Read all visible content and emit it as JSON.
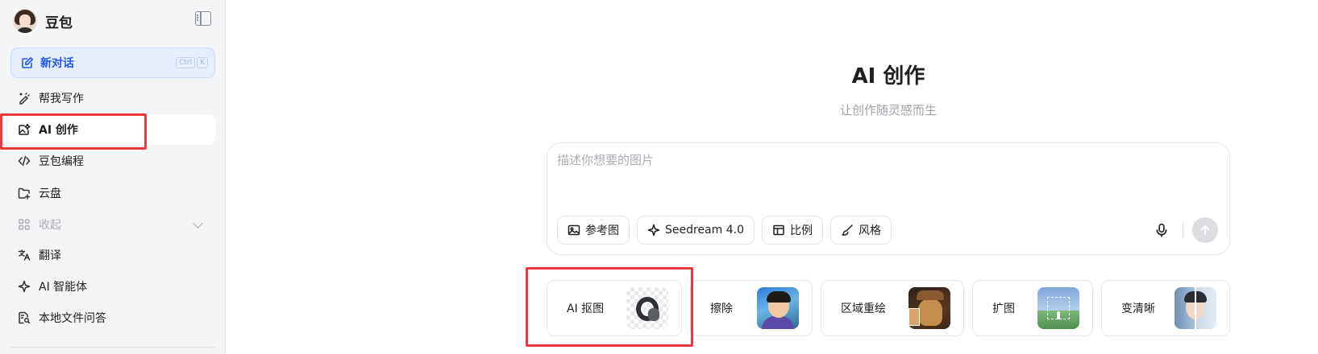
{
  "sidebar": {
    "app_name": "豆包",
    "new_chat": {
      "label": "新对话",
      "shortcut": [
        "Ctrl",
        "K"
      ]
    },
    "items": [
      {
        "label": "帮我写作",
        "icon": "pen-sparkle-icon"
      },
      {
        "label": "AI 创作",
        "icon": "image-edit-icon",
        "active": true
      },
      {
        "label": "豆包编程",
        "icon": "code-icon"
      },
      {
        "label": "云盘",
        "icon": "cloud-folder-icon"
      },
      {
        "label": "收起",
        "icon": "apps-grid-icon",
        "muted": true
      },
      {
        "label": "翻译",
        "icon": "translate-icon"
      },
      {
        "label": "AI 智能体",
        "icon": "sparkle-icon"
      },
      {
        "label": "本地文件问答",
        "icon": "file-search-icon"
      }
    ]
  },
  "main": {
    "title": "AI 创作",
    "subtitle": "让创作随灵感而生",
    "composer": {
      "placeholder": "描述你想要的图片",
      "chips": [
        {
          "label": "参考图",
          "icon": "image-icon"
        },
        {
          "label": "Seedream 4.0",
          "icon": "sparkle-icon"
        },
        {
          "label": "比例",
          "icon": "layout-icon"
        },
        {
          "label": "风格",
          "icon": "brush-icon"
        }
      ]
    },
    "tools": [
      {
        "label": "AI 抠图"
      },
      {
        "label": "擦除"
      },
      {
        "label": "区域重绘"
      },
      {
        "label": "扩图"
      },
      {
        "label": "变清晰"
      }
    ]
  },
  "colors": {
    "accent": "#2157e8",
    "highlight": "#e8393d",
    "sidebar_bg": "#f4f5f7"
  }
}
